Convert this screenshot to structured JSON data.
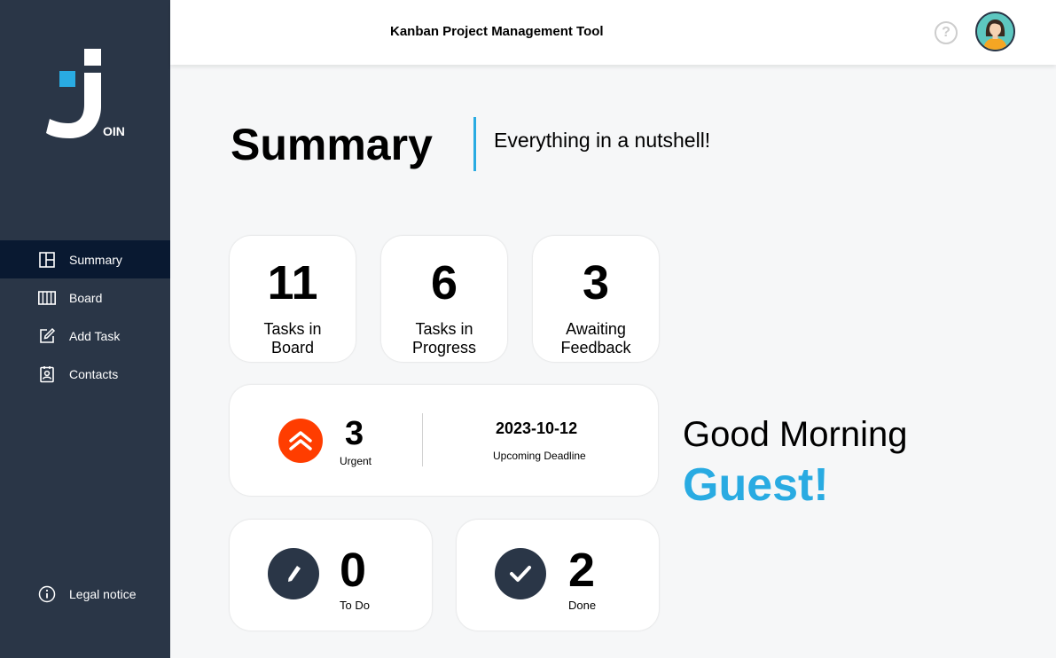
{
  "app": {
    "title": "Kanban Project Management Tool",
    "logo_text": "OIN"
  },
  "sidebar": {
    "items": [
      {
        "label": "Summary",
        "icon": "summary-icon",
        "active": true
      },
      {
        "label": "Board",
        "icon": "board-icon",
        "active": false
      },
      {
        "label": "Add Task",
        "icon": "edit-icon",
        "active": false
      },
      {
        "label": "Contacts",
        "icon": "contacts-icon",
        "active": false
      }
    ],
    "legal": {
      "label": "Legal notice",
      "icon": "info-icon"
    }
  },
  "header": {
    "help_icon": "?",
    "avatar": "user-avatar"
  },
  "page": {
    "title": "Summary",
    "subtitle": "Everything in a nutshell!"
  },
  "stats": [
    {
      "value": "11",
      "label": "Tasks in Board"
    },
    {
      "value": "6",
      "label": "Tasks in Progress"
    },
    {
      "value": "3",
      "label": "Awaiting Feedback"
    }
  ],
  "urgent": {
    "value": "3",
    "label": "Urgent",
    "deadline_date": "2023-10-12",
    "deadline_label": "Upcoming Deadline"
  },
  "todo": {
    "value": "0",
    "label": "To Do"
  },
  "done": {
    "value": "2",
    "label": "Done"
  },
  "greeting": {
    "text": "Good Morning",
    "name": "Guest!"
  },
  "colors": {
    "sidebar": "#2a3647",
    "sidebar_active": "#091931",
    "accent": "#29abe2",
    "urgent": "#ff3d00"
  }
}
